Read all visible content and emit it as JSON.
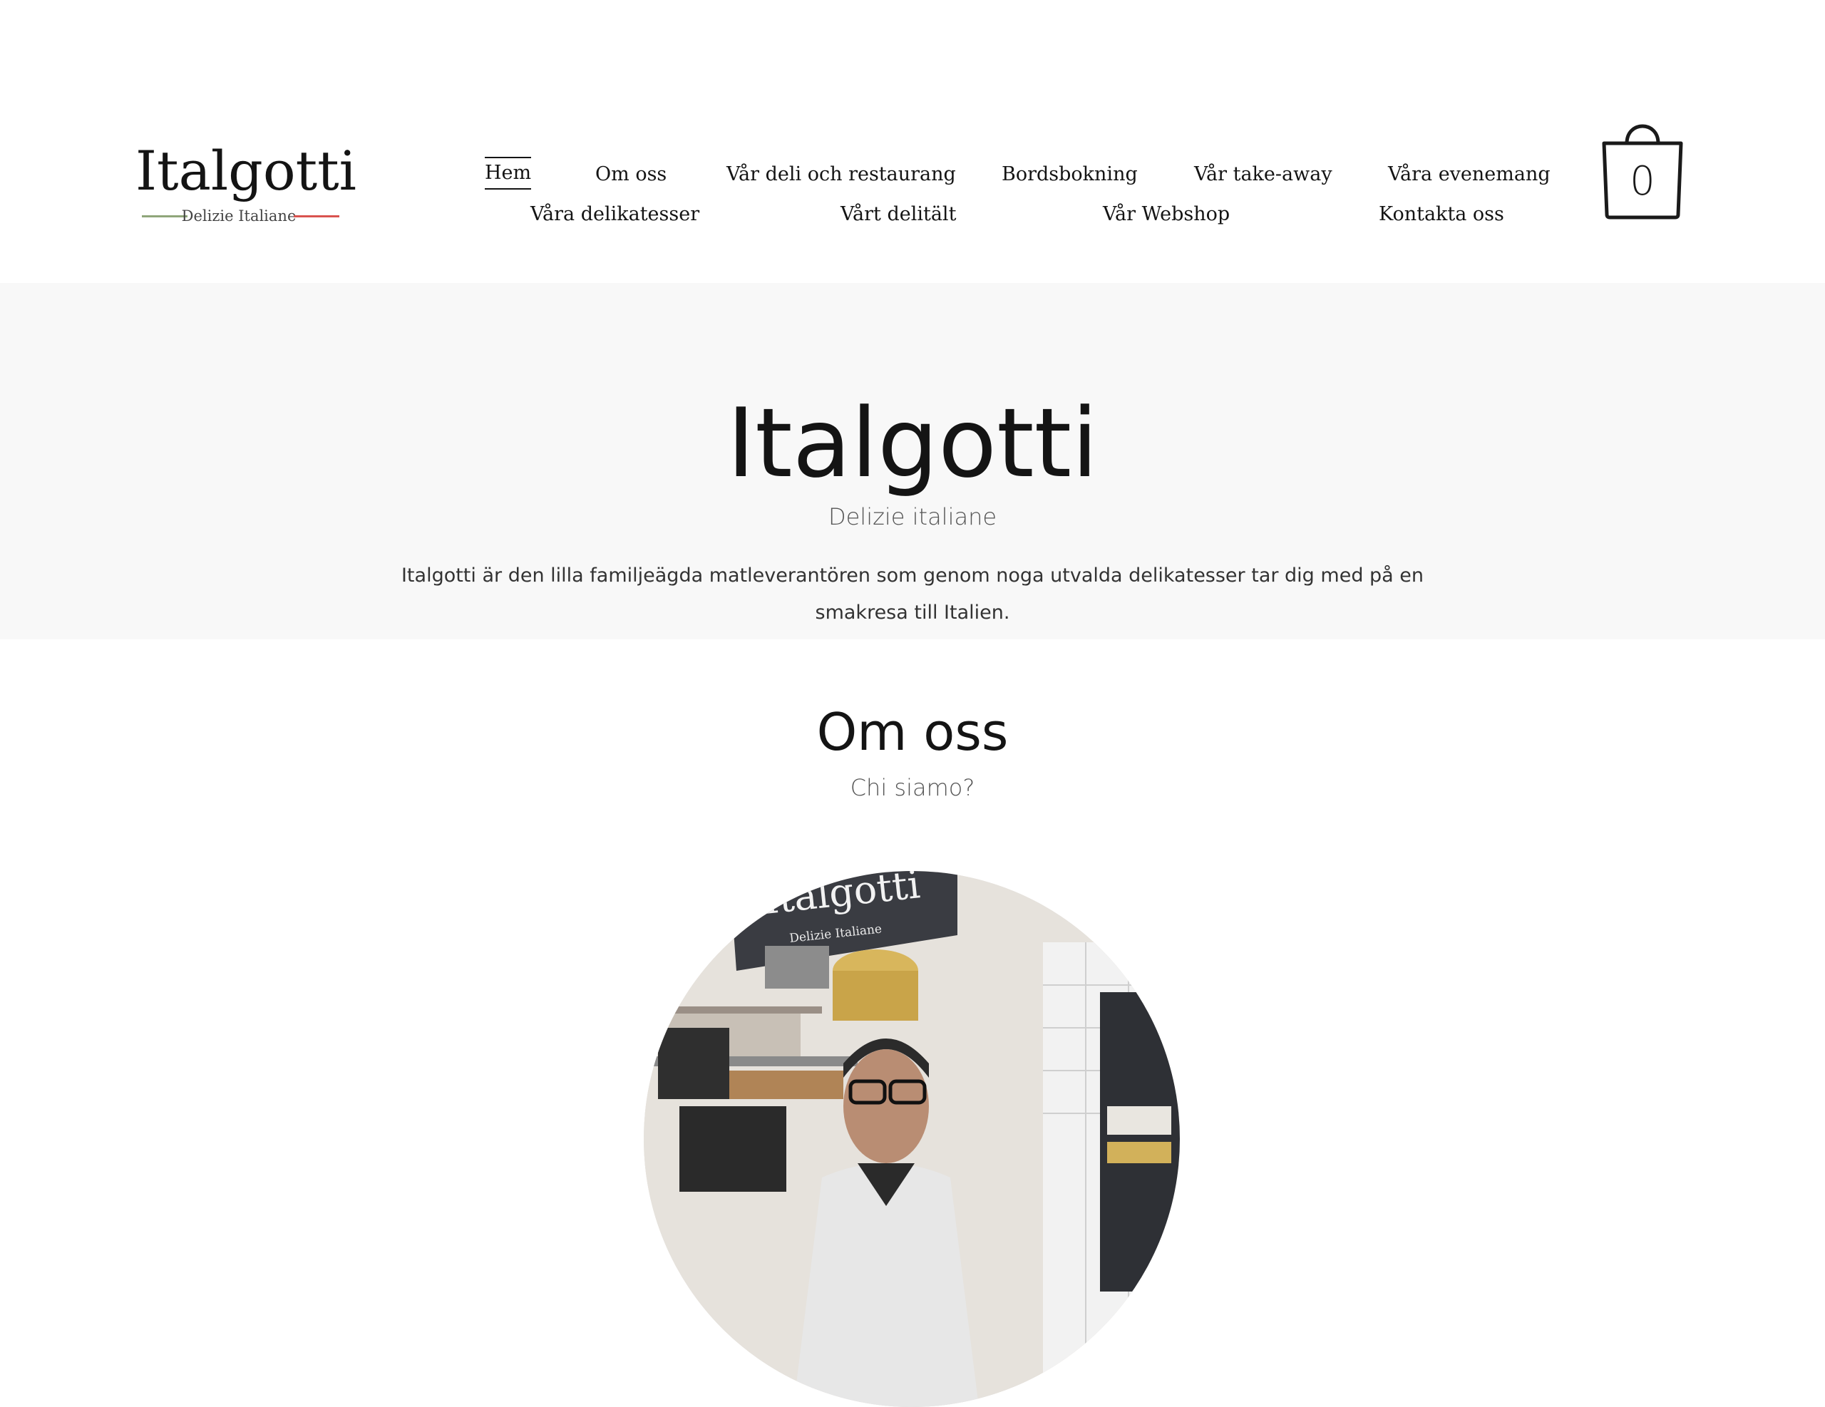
{
  "logo": {
    "name": "Italgotti",
    "tagline": "Delizie Italiane"
  },
  "nav": {
    "items": [
      {
        "label": "Hem",
        "active": true
      },
      {
        "label": "Om oss"
      },
      {
        "label": "Vår deli och restaurang"
      },
      {
        "label": "Bordsbokning"
      },
      {
        "label": "Vår take-away"
      },
      {
        "label": "Våra evenemang"
      },
      {
        "label": "Våra delikatesser"
      },
      {
        "label": "Vårt delitält"
      },
      {
        "label": "Vår Webshop"
      },
      {
        "label": "Kontakta oss"
      }
    ]
  },
  "cart": {
    "count": "0",
    "icon": "shopping-bag-icon"
  },
  "hero": {
    "title": "Italgotti",
    "subtitle": "Delizie italiane",
    "text": "Italgotti är den lilla familjeägda matleverantören som genom noga utvalda delikatesser tar dig med på en smakresa till Italien."
  },
  "about": {
    "title": "Om oss",
    "subtitle": "Chi siamo?",
    "photo_sign": "Italgotti",
    "photo_sign_tagline": "Delizie Italiane"
  },
  "colors": {
    "hero_bg": "#f8f8f8",
    "logo_green": "#8fa67a",
    "logo_red": "#d9534f",
    "text": "#141414"
  }
}
